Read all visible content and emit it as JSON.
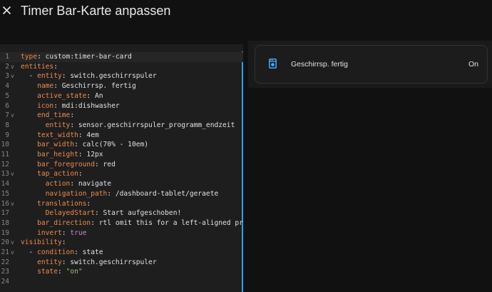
{
  "header": {
    "title": "Timer Bar-Karte anpassen",
    "close_icon": "close-icon"
  },
  "editor": {
    "lines": [
      {
        "n": "1",
        "fold": "",
        "segs": [
          {
            "c": "k",
            "t": "type"
          },
          {
            "c": "v",
            "t": ": custom:timer-bar-card"
          }
        ]
      },
      {
        "n": "2",
        "fold": "v",
        "segs": [
          {
            "c": "k",
            "t": "entities"
          },
          {
            "c": "v",
            "t": ":"
          }
        ]
      },
      {
        "n": "3",
        "fold": "v",
        "segs": [
          {
            "c": "v",
            "t": "  - "
          },
          {
            "c": "k",
            "t": "entity"
          },
          {
            "c": "v",
            "t": ": switch.geschirrspuler"
          }
        ]
      },
      {
        "n": "4",
        "fold": "",
        "segs": [
          {
            "c": "v",
            "t": "    "
          },
          {
            "c": "k",
            "t": "name"
          },
          {
            "c": "v",
            "t": ": Geschirrsp. fertig"
          }
        ]
      },
      {
        "n": "5",
        "fold": "",
        "segs": [
          {
            "c": "v",
            "t": "    "
          },
          {
            "c": "k",
            "t": "active_state"
          },
          {
            "c": "v",
            "t": ": An"
          }
        ]
      },
      {
        "n": "6",
        "fold": "",
        "segs": [
          {
            "c": "v",
            "t": "    "
          },
          {
            "c": "k",
            "t": "icon"
          },
          {
            "c": "v",
            "t": ": mdi:dishwasher"
          }
        ]
      },
      {
        "n": "7",
        "fold": "v",
        "segs": [
          {
            "c": "v",
            "t": "    "
          },
          {
            "c": "k",
            "t": "end_time"
          },
          {
            "c": "v",
            "t": ":"
          }
        ]
      },
      {
        "n": "8",
        "fold": "",
        "segs": [
          {
            "c": "v",
            "t": "      "
          },
          {
            "c": "k",
            "t": "entity"
          },
          {
            "c": "v",
            "t": ": sensor.geschirrspuler_programm_endzeit"
          }
        ]
      },
      {
        "n": "9",
        "fold": "",
        "segs": [
          {
            "c": "v",
            "t": "    "
          },
          {
            "c": "k",
            "t": "text_width"
          },
          {
            "c": "v",
            "t": ": 4em"
          }
        ]
      },
      {
        "n": "10",
        "fold": "",
        "segs": [
          {
            "c": "v",
            "t": "    "
          },
          {
            "c": "k",
            "t": "bar_width"
          },
          {
            "c": "v",
            "t": ": calc(70% - 10em)"
          }
        ]
      },
      {
        "n": "11",
        "fold": "",
        "segs": [
          {
            "c": "v",
            "t": "    "
          },
          {
            "c": "k",
            "t": "bar_height"
          },
          {
            "c": "v",
            "t": ": 12px"
          }
        ]
      },
      {
        "n": "12",
        "fold": "",
        "segs": [
          {
            "c": "v",
            "t": "    "
          },
          {
            "c": "k",
            "t": "bar_foreground"
          },
          {
            "c": "v",
            "t": ": red"
          }
        ]
      },
      {
        "n": "13",
        "fold": "v",
        "segs": [
          {
            "c": "v",
            "t": "    "
          },
          {
            "c": "k",
            "t": "tap_action"
          },
          {
            "c": "v",
            "t": ":"
          }
        ]
      },
      {
        "n": "14",
        "fold": "",
        "segs": [
          {
            "c": "v",
            "t": "      "
          },
          {
            "c": "k",
            "t": "action"
          },
          {
            "c": "v",
            "t": ": navigate"
          }
        ]
      },
      {
        "n": "15",
        "fold": "",
        "segs": [
          {
            "c": "v",
            "t": "      "
          },
          {
            "c": "k",
            "t": "navigation_path"
          },
          {
            "c": "v",
            "t": ": /dashboard-tablet/geraete"
          }
        ]
      },
      {
        "n": "16",
        "fold": "v",
        "segs": [
          {
            "c": "v",
            "t": "    "
          },
          {
            "c": "k",
            "t": "translations"
          },
          {
            "c": "v",
            "t": ":"
          }
        ]
      },
      {
        "n": "17",
        "fold": "",
        "segs": [
          {
            "c": "v",
            "t": "      "
          },
          {
            "c": "k",
            "t": "DelayedStart"
          },
          {
            "c": "v",
            "t": ": Start aufgeschoben!"
          }
        ]
      },
      {
        "n": "18",
        "fold": "",
        "segs": [
          {
            "c": "v",
            "t": "    "
          },
          {
            "c": "k",
            "t": "bar_direction"
          },
          {
            "c": "v",
            "t": ": rtl omit this for a left-aligned pro"
          }
        ]
      },
      {
        "n": "19",
        "fold": "",
        "segs": [
          {
            "c": "v",
            "t": "    "
          },
          {
            "c": "k",
            "t": "invert"
          },
          {
            "c": "v",
            "t": ": "
          },
          {
            "c": "b",
            "t": "true"
          }
        ]
      },
      {
        "n": "20",
        "fold": "v",
        "segs": [
          {
            "c": "k",
            "t": "visibility"
          },
          {
            "c": "v",
            "t": ":"
          }
        ]
      },
      {
        "n": "21",
        "fold": "v",
        "segs": [
          {
            "c": "v",
            "t": "  - "
          },
          {
            "c": "k",
            "t": "condition"
          },
          {
            "c": "v",
            "t": ": state"
          }
        ]
      },
      {
        "n": "22",
        "fold": "",
        "segs": [
          {
            "c": "v",
            "t": "    "
          },
          {
            "c": "k",
            "t": "entity"
          },
          {
            "c": "v",
            "t": ": switch.geschirrspuler"
          }
        ]
      },
      {
        "n": "23",
        "fold": "",
        "segs": [
          {
            "c": "v",
            "t": "    "
          },
          {
            "c": "k",
            "t": "state"
          },
          {
            "c": "v",
            "t": ": "
          },
          {
            "c": "s",
            "t": "\"on\""
          }
        ]
      },
      {
        "n": "24",
        "fold": "",
        "segs": []
      }
    ]
  },
  "preview": {
    "entity_icon": "dishwasher-icon",
    "entity_name": "Geschirrsp. fertig",
    "entity_state": "On"
  },
  "colors": {
    "yaml_key": "#ee8b4c",
    "yaml_value": "#e0e0e0",
    "yaml_string": "#98c379",
    "yaml_boolean": "#c586c0",
    "cursor_line": "#2aa0e5",
    "icon_blue": "#44a8ff"
  }
}
